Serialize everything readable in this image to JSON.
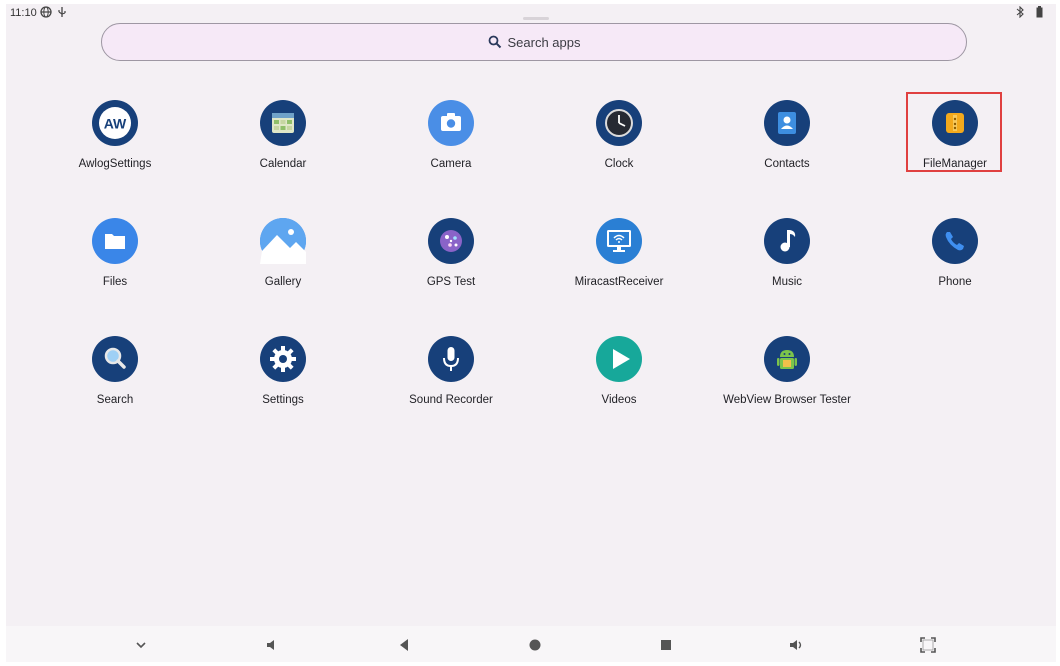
{
  "status_bar": {
    "time": "11:10"
  },
  "search": {
    "placeholder": "Search apps"
  },
  "apps": [
    {
      "label": "AwlogSettings"
    },
    {
      "label": "Calendar"
    },
    {
      "label": "Camera"
    },
    {
      "label": "Clock"
    },
    {
      "label": "Contacts"
    },
    {
      "label": "FileManager"
    },
    {
      "label": "Files"
    },
    {
      "label": "Gallery"
    },
    {
      "label": "GPS Test"
    },
    {
      "label": "MiracastReceiver"
    },
    {
      "label": "Music"
    },
    {
      "label": "Phone"
    },
    {
      "label": "Search"
    },
    {
      "label": "Settings"
    },
    {
      "label": "Sound Recorder"
    },
    {
      "label": "Videos"
    },
    {
      "label": "WebView Browser Tester"
    }
  ],
  "awlog_icon_text": "AW",
  "colors": {
    "icon_bg": "#17407a",
    "highlight": "#e04040",
    "search_bg": "#f6e9f7"
  }
}
